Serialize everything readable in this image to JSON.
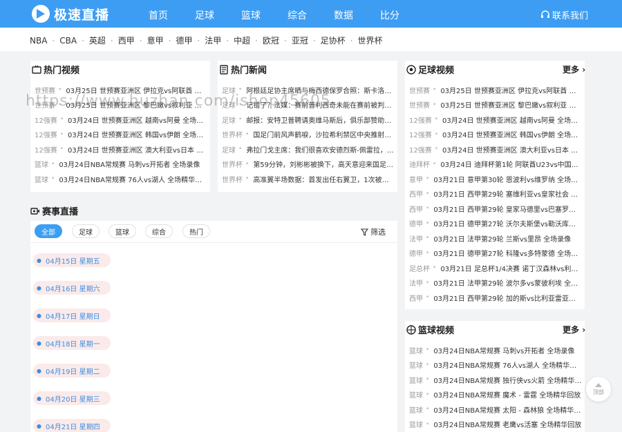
{
  "header": {
    "logo_text": "极速直播",
    "nav": [
      "首页",
      "足球",
      "篮球",
      "综合",
      "数据",
      "比分"
    ],
    "contact_label": "联系我们",
    "accent_color": "#3d9df3"
  },
  "league_bar": {
    "items": [
      "NBA",
      "CBA",
      "英超",
      "西甲",
      "意甲",
      "德甲",
      "法甲",
      "中超",
      "欧冠",
      "亚冠",
      "足协杯",
      "世界杯"
    ]
  },
  "hot_videos": {
    "title": "热门视频",
    "rows": [
      {
        "tag": "世预赛",
        "text": "03月25日 世预赛亚洲区 伊拉克vs阿联酋 全场录像"
      },
      {
        "tag": "世预赛",
        "text": "03月25日 世预赛亚洲区 黎巴嫩vs叙利亚 全场录像"
      },
      {
        "tag": "12强赛",
        "text": "03月24日 世预赛亚洲区 越南vs阿曼 全场录像"
      },
      {
        "tag": "12强赛",
        "text": "03月24日 世预赛亚洲区 韩国vs伊朗 全场录像"
      },
      {
        "tag": "12强赛",
        "text": "03月24日 世预赛亚洲区 澳大利亚vs日本 全场录像"
      },
      {
        "tag": "篮球",
        "text": "03月24日NBA常规赛 马刺vs开拓者 全场录像"
      },
      {
        "tag": "篮球",
        "text": "03月24日NBA常规赛 76人vs湖人 全场精华回放"
      }
    ]
  },
  "hot_news": {
    "title": "热门新闻",
    "rows": [
      {
        "tag": "足球",
        "text": "阿根廷足协主席晒与梅西德保罗合照：斯卡洛尼的..."
      },
      {
        "tag": "足球",
        "text": "记错了？法媒：赛前普利西奇未能在赛前被判越位在先..."
      },
      {
        "tag": "足球",
        "text": "邮报：安特卫普聘请奥维马斯后，俱乐部赞助商宣..."
      },
      {
        "tag": "世界杯",
        "text": "国足门前风声鹤唳，沙拉希利禁区中央推射偏出..."
      },
      {
        "tag": "足球",
        "text": "弗拉门戈主席：我们很喜欢安德烈斯-佩雷拉，已..."
      },
      {
        "tag": "世界杯",
        "text": "第59分钟，刘彬彬被换下，高天意迎来国足首秀"
      },
      {
        "tag": "世界杯",
        "text": "高准翼半场数据：首发出任右翼卫，1次被过，..."
      }
    ]
  },
  "football_videos": {
    "title": "足球视频",
    "more": "更多",
    "rows": [
      {
        "tag": "世预赛",
        "text": "03月25日 世预赛亚洲区 伊拉克vs阿联酋 全场录像"
      },
      {
        "tag": "世预赛",
        "text": "03月25日 世预赛亚洲区 黎巴嫩vs叙利亚 全场录像"
      },
      {
        "tag": "12强赛",
        "text": "03月24日 世预赛亚洲区 越南vs阿曼 全场录像"
      },
      {
        "tag": "12强赛",
        "text": "03月24日 世预赛亚洲区 韩国vs伊朗 全场录像"
      },
      {
        "tag": "12强赛",
        "text": "03月24日 世预赛亚洲区 澳大利亚vs日本 全场录像"
      },
      {
        "tag": "迪拜杯",
        "text": "03月24日 迪拜杯第1轮 阿联酋U23vs中国U23 全场"
      },
      {
        "tag": "意甲",
        "text": "03月21日 意甲第30轮 恩波利vs维罗纳 全场录像"
      },
      {
        "tag": "西甲",
        "text": "03月21日 西甲第29轮 塞维利亚vs皇家社会 全场录像"
      },
      {
        "tag": "西甲",
        "text": "03月21日 西甲第29轮 皇家马德里vs巴塞罗那 全场录像"
      },
      {
        "tag": "德甲",
        "text": "03月21日 德甲第27轮 沃尔夫斯堡vs勒沃库森 全场录像"
      },
      {
        "tag": "法甲",
        "text": "03月21日 法甲第29轮 兰斯vs里昂 全场录像"
      },
      {
        "tag": "德甲",
        "text": "03月21日 德甲第27轮 科隆vs多特蒙德 全场录像"
      },
      {
        "tag": "足总杯",
        "text": "03月21日 足总杯1/4决赛 诺丁汉森林vs利物浦 全场"
      },
      {
        "tag": "法甲",
        "text": "03月21日 法甲第29轮 波尔多vs蒙彼利埃 全场录像"
      },
      {
        "tag": "西甲",
        "text": "03月21日 西甲第29轮 加的斯vs比利亚雷亚尔 全场录像"
      }
    ]
  },
  "basketball_videos": {
    "title": "篮球视频",
    "more": "更多",
    "rows": [
      {
        "tag": "篮球",
        "text": "03月24日NBA常规赛 马刺vs开拓者 全场录像"
      },
      {
        "tag": "篮球",
        "text": "03月24日NBA常规赛 76人vs湖人 全场精华回放"
      },
      {
        "tag": "篮球",
        "text": "03月24日NBA常规赛 独行侠vs火箭 全场精华回放"
      },
      {
        "tag": "篮球",
        "text": "03月24日NBA常规赛 魔术 - 雷霆 全场精华回放"
      },
      {
        "tag": "篮球",
        "text": "03月24日NBA常规赛 太阳 - 森林狼 全场精华回放"
      },
      {
        "tag": "篮球",
        "text": "03月24日NBA常规赛 老鹰vs活塞 全场精华回放"
      }
    ]
  },
  "live": {
    "title": "赛事直播",
    "filters": [
      "全部",
      "足球",
      "篮球",
      "综合",
      "热门"
    ],
    "filter_button": "筛选",
    "dates": [
      "04月15日 星期五",
      "04月16日 星期六",
      "04月17日 星期日",
      "04月18日 星期一",
      "04月19日 星期二",
      "04月20日 星期三",
      "04月21日 星期四"
    ]
  },
  "back_to_top": "顶部",
  "watermark": "https://www.huzhan.com/ishop45605"
}
